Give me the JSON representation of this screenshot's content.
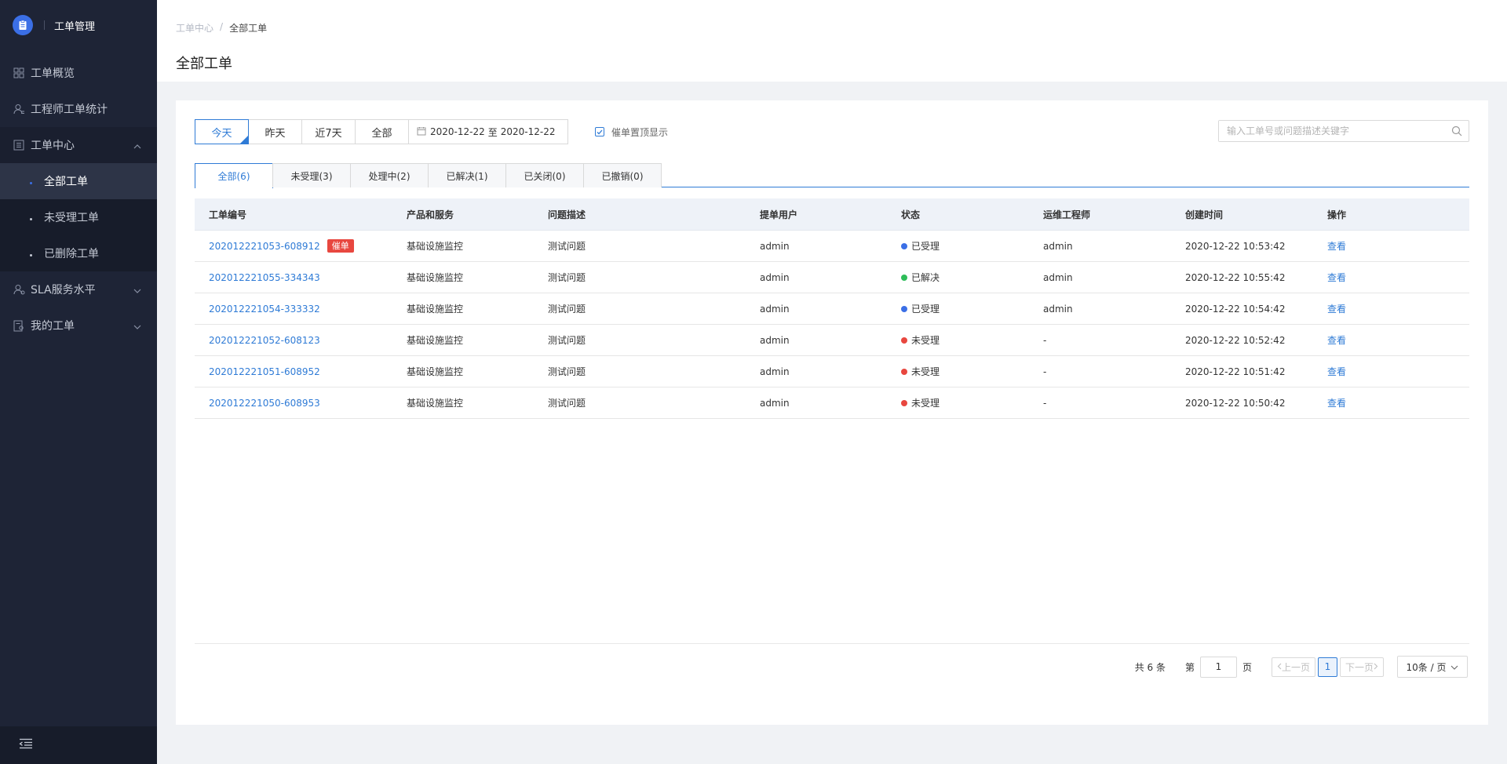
{
  "app": {
    "title": "工单管理"
  },
  "sidebar": {
    "items": [
      {
        "label": "工单概览",
        "icon": "dashboard-icon"
      },
      {
        "label": "工程师工单统计",
        "icon": "user-stats-icon"
      },
      {
        "label": "工单中心",
        "icon": "list-icon",
        "expanded": true,
        "children": [
          {
            "label": "全部工单",
            "active": true
          },
          {
            "label": "未受理工单"
          },
          {
            "label": "已删除工单"
          }
        ]
      },
      {
        "label": "SLA服务水平",
        "icon": "user-sla-icon"
      },
      {
        "label": "我的工单",
        "icon": "my-order-icon"
      }
    ]
  },
  "header": {
    "breadcrumb": [
      "工单中心",
      "全部工单"
    ],
    "title": "全部工单"
  },
  "filters": {
    "ranges": [
      "今天",
      "昨天",
      "近7天",
      "全部"
    ],
    "active_range": "今天",
    "date_start": "2020-12-22",
    "date_sep": "至",
    "date_end": "2020-12-22",
    "urgent_top_label": "催单置顶显示",
    "urgent_top_checked": true
  },
  "search": {
    "placeholder": "输入工单号或问题描述关键字"
  },
  "tabs": [
    "全部(6)",
    "未受理(3)",
    "处理中(2)",
    "已解决(1)",
    "已关闭(0)",
    "已撤销(0)"
  ],
  "table": {
    "columns": [
      "工单编号",
      "产品和服务",
      "问题描述",
      "提单用户",
      "状态",
      "运维工程师",
      "创建时间",
      "操作"
    ],
    "rows": [
      {
        "id": "202012221053-608912",
        "badge": "催单",
        "product": "基础设施监控",
        "desc": "测试问题",
        "user": "admin",
        "status": "已受理",
        "status_color": "#3b6fe6",
        "engineer": "admin",
        "created": "2020-12-22 10:53:42",
        "action": "查看"
      },
      {
        "id": "202012221055-334343",
        "badge": "",
        "product": "基础设施监控",
        "desc": "测试问题",
        "user": "admin",
        "status": "已解决",
        "status_color": "#2ebd59",
        "engineer": "admin",
        "created": "2020-12-22 10:55:42",
        "action": "查看"
      },
      {
        "id": "202012221054-333332",
        "badge": "",
        "product": "基础设施监控",
        "desc": "测试问题",
        "user": "admin",
        "status": "已受理",
        "status_color": "#3b6fe6",
        "engineer": "admin",
        "created": "2020-12-22 10:54:42",
        "action": "查看"
      },
      {
        "id": "202012221052-608123",
        "badge": "",
        "product": "基础设施监控",
        "desc": "测试问题",
        "user": "admin",
        "status": "未受理",
        "status_color": "#e8473f",
        "engineer": "-",
        "created": "2020-12-22 10:52:42",
        "action": "查看"
      },
      {
        "id": "202012221051-608952",
        "badge": "",
        "product": "基础设施监控",
        "desc": "测试问题",
        "user": "admin",
        "status": "未受理",
        "status_color": "#e8473f",
        "engineer": "-",
        "created": "2020-12-22 10:51:42",
        "action": "查看"
      },
      {
        "id": "202012221050-608953",
        "badge": "",
        "product": "基础设施监控",
        "desc": "测试问题",
        "user": "admin",
        "status": "未受理",
        "status_color": "#e8473f",
        "engineer": "-",
        "created": "2020-12-22 10:50:42",
        "action": "查看"
      }
    ]
  },
  "pagination": {
    "total": "共 6 条",
    "page_prefix": "第",
    "page_value": "1",
    "page_suffix": "页",
    "prev": "上一页",
    "current": "1",
    "next": "下一页",
    "page_size": "10条 / 页"
  },
  "colors": {
    "sidebar_bg": "#1e2436",
    "accent": "#2f7bd6",
    "badge_red": "#e8473f"
  }
}
